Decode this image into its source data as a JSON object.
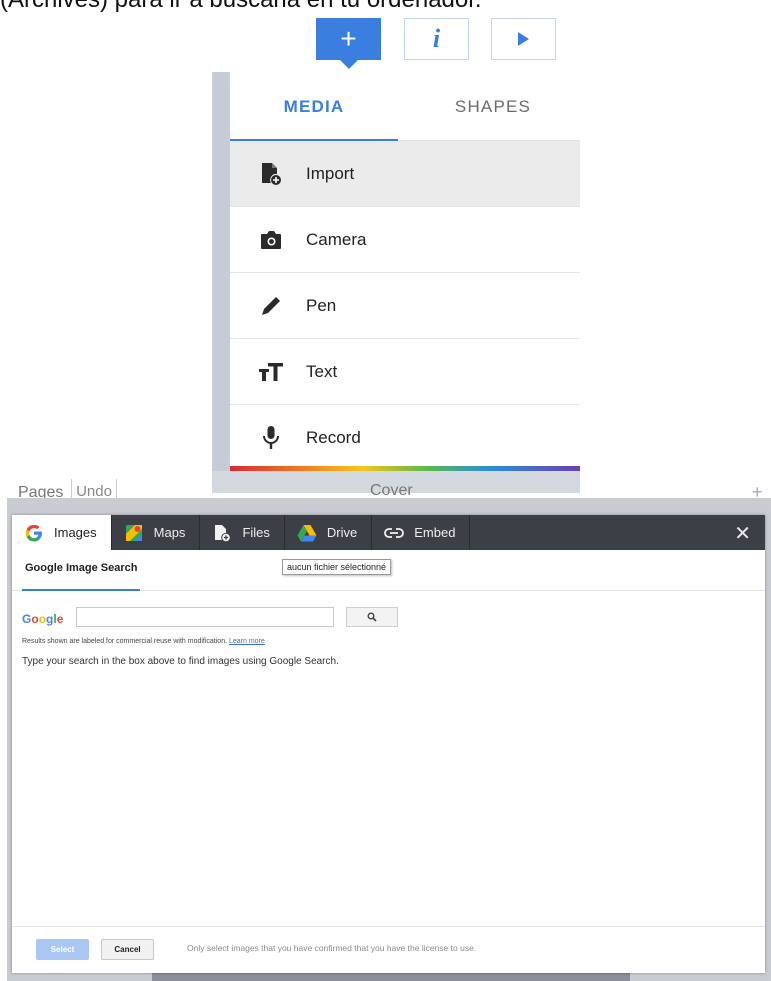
{
  "caption": "(Archives) para ir a buscarla en tu ordenador.",
  "toolbar": {
    "add_symbol": "+",
    "info_symbol": "i",
    "add_icon": "plus-icon",
    "info_icon": "info-icon",
    "play_icon": "play-icon",
    "accent_color": "#3a7ee0"
  },
  "media_menu": {
    "tabs": [
      {
        "label": "MEDIA",
        "active": true
      },
      {
        "label": "SHAPES",
        "active": false
      }
    ],
    "items": [
      {
        "label": "Import",
        "icon": "import-file-icon",
        "active": true
      },
      {
        "label": "Camera",
        "icon": "camera-icon",
        "active": false
      },
      {
        "label": "Pen",
        "icon": "pen-icon",
        "active": false
      },
      {
        "label": "Text",
        "icon": "text-icon",
        "active": false
      },
      {
        "label": "Record",
        "icon": "microphone-icon",
        "active": false
      }
    ]
  },
  "editor": {
    "pages_label": "Pages",
    "undo_label": "Undo",
    "cover_label": "Cover",
    "add_symbol": "+"
  },
  "picker": {
    "tabs": [
      {
        "label": "Images",
        "icon": "google-icon",
        "active": true
      },
      {
        "label": "Maps",
        "icon": "maps-icon",
        "active": false
      },
      {
        "label": "Files",
        "icon": "file-add-icon",
        "active": false
      },
      {
        "label": "Drive",
        "icon": "drive-icon",
        "active": false
      },
      {
        "label": "Embed",
        "icon": "link-icon",
        "active": false
      }
    ],
    "close_symbol": "✕",
    "subhead": "Google Image Search",
    "tooltip": "aucun fichier sélectionné",
    "search": {
      "logo": "Google",
      "value": "",
      "button_icon": "search-icon"
    },
    "note_text": "Results shown are labeled for commercial reuse with modification.",
    "note_link": "Learn more",
    "hint": "Type your search in the box above to find images using Google Search.",
    "footer": {
      "select_label": "Select",
      "cancel_label": "Cancel",
      "license_text": "Only select images that you have confirmed that you have the license to use."
    }
  }
}
